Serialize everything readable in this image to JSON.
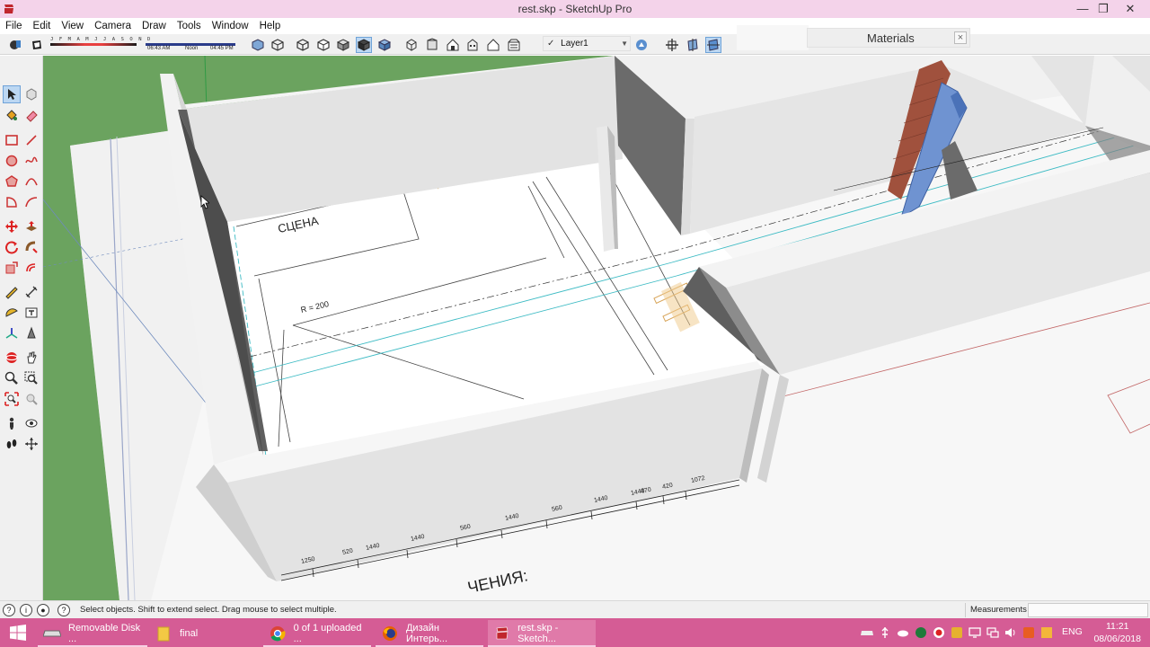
{
  "window": {
    "title": "rest.skp - SketchUp Pro",
    "minimize": "—",
    "maximize": "❐",
    "close": "✕"
  },
  "menu": [
    "File",
    "Edit",
    "View",
    "Camera",
    "Draw",
    "Tools",
    "Window",
    "Help"
  ],
  "shadow_settings": {
    "months": "J F M A M J J A S O N D",
    "time_start": "06:43 AM",
    "time_mid": "Noon",
    "time_end": "04:45 PM"
  },
  "layer": {
    "name": "Layer1",
    "check": "✓"
  },
  "tray_panel": {
    "title": "Materials",
    "close": "×"
  },
  "viewport_labels": {
    "stage": "СЦЕНА",
    "radius": "R = 200",
    "bottom_text": "ЧЕНИЯ:",
    "dims_bottom": [
      "1250",
      "520",
      "1440",
      "1440",
      "1440",
      "560",
      "1440",
      "560",
      "1440",
      "470",
      "420",
      "1072"
    ]
  },
  "status": {
    "hint": "Select objects. Shift to extend select. Drag mouse to select multiple.",
    "measurements_label": "Measurements",
    "measurements_value": ""
  },
  "taskbar": {
    "items": [
      {
        "label": "Removable Disk ...",
        "icon": "drive-icon"
      },
      {
        "label": "final",
        "icon": "folder-icon"
      },
      {
        "label": "0 of 1 uploaded ...",
        "icon": "chrome-icon"
      },
      {
        "label": "Дизайн Интерь...",
        "icon": "firefox-icon"
      },
      {
        "label": "rest.skp - Sketch...",
        "icon": "sketchup-icon"
      }
    ],
    "language": "ENG",
    "time": "11:21",
    "date": "08/06/2018"
  },
  "colors": {
    "titlebar": "#f4d3ea",
    "taskbar": "#d55c95",
    "ground": "#6ba35f",
    "accent_select": "#bcd7f2"
  }
}
